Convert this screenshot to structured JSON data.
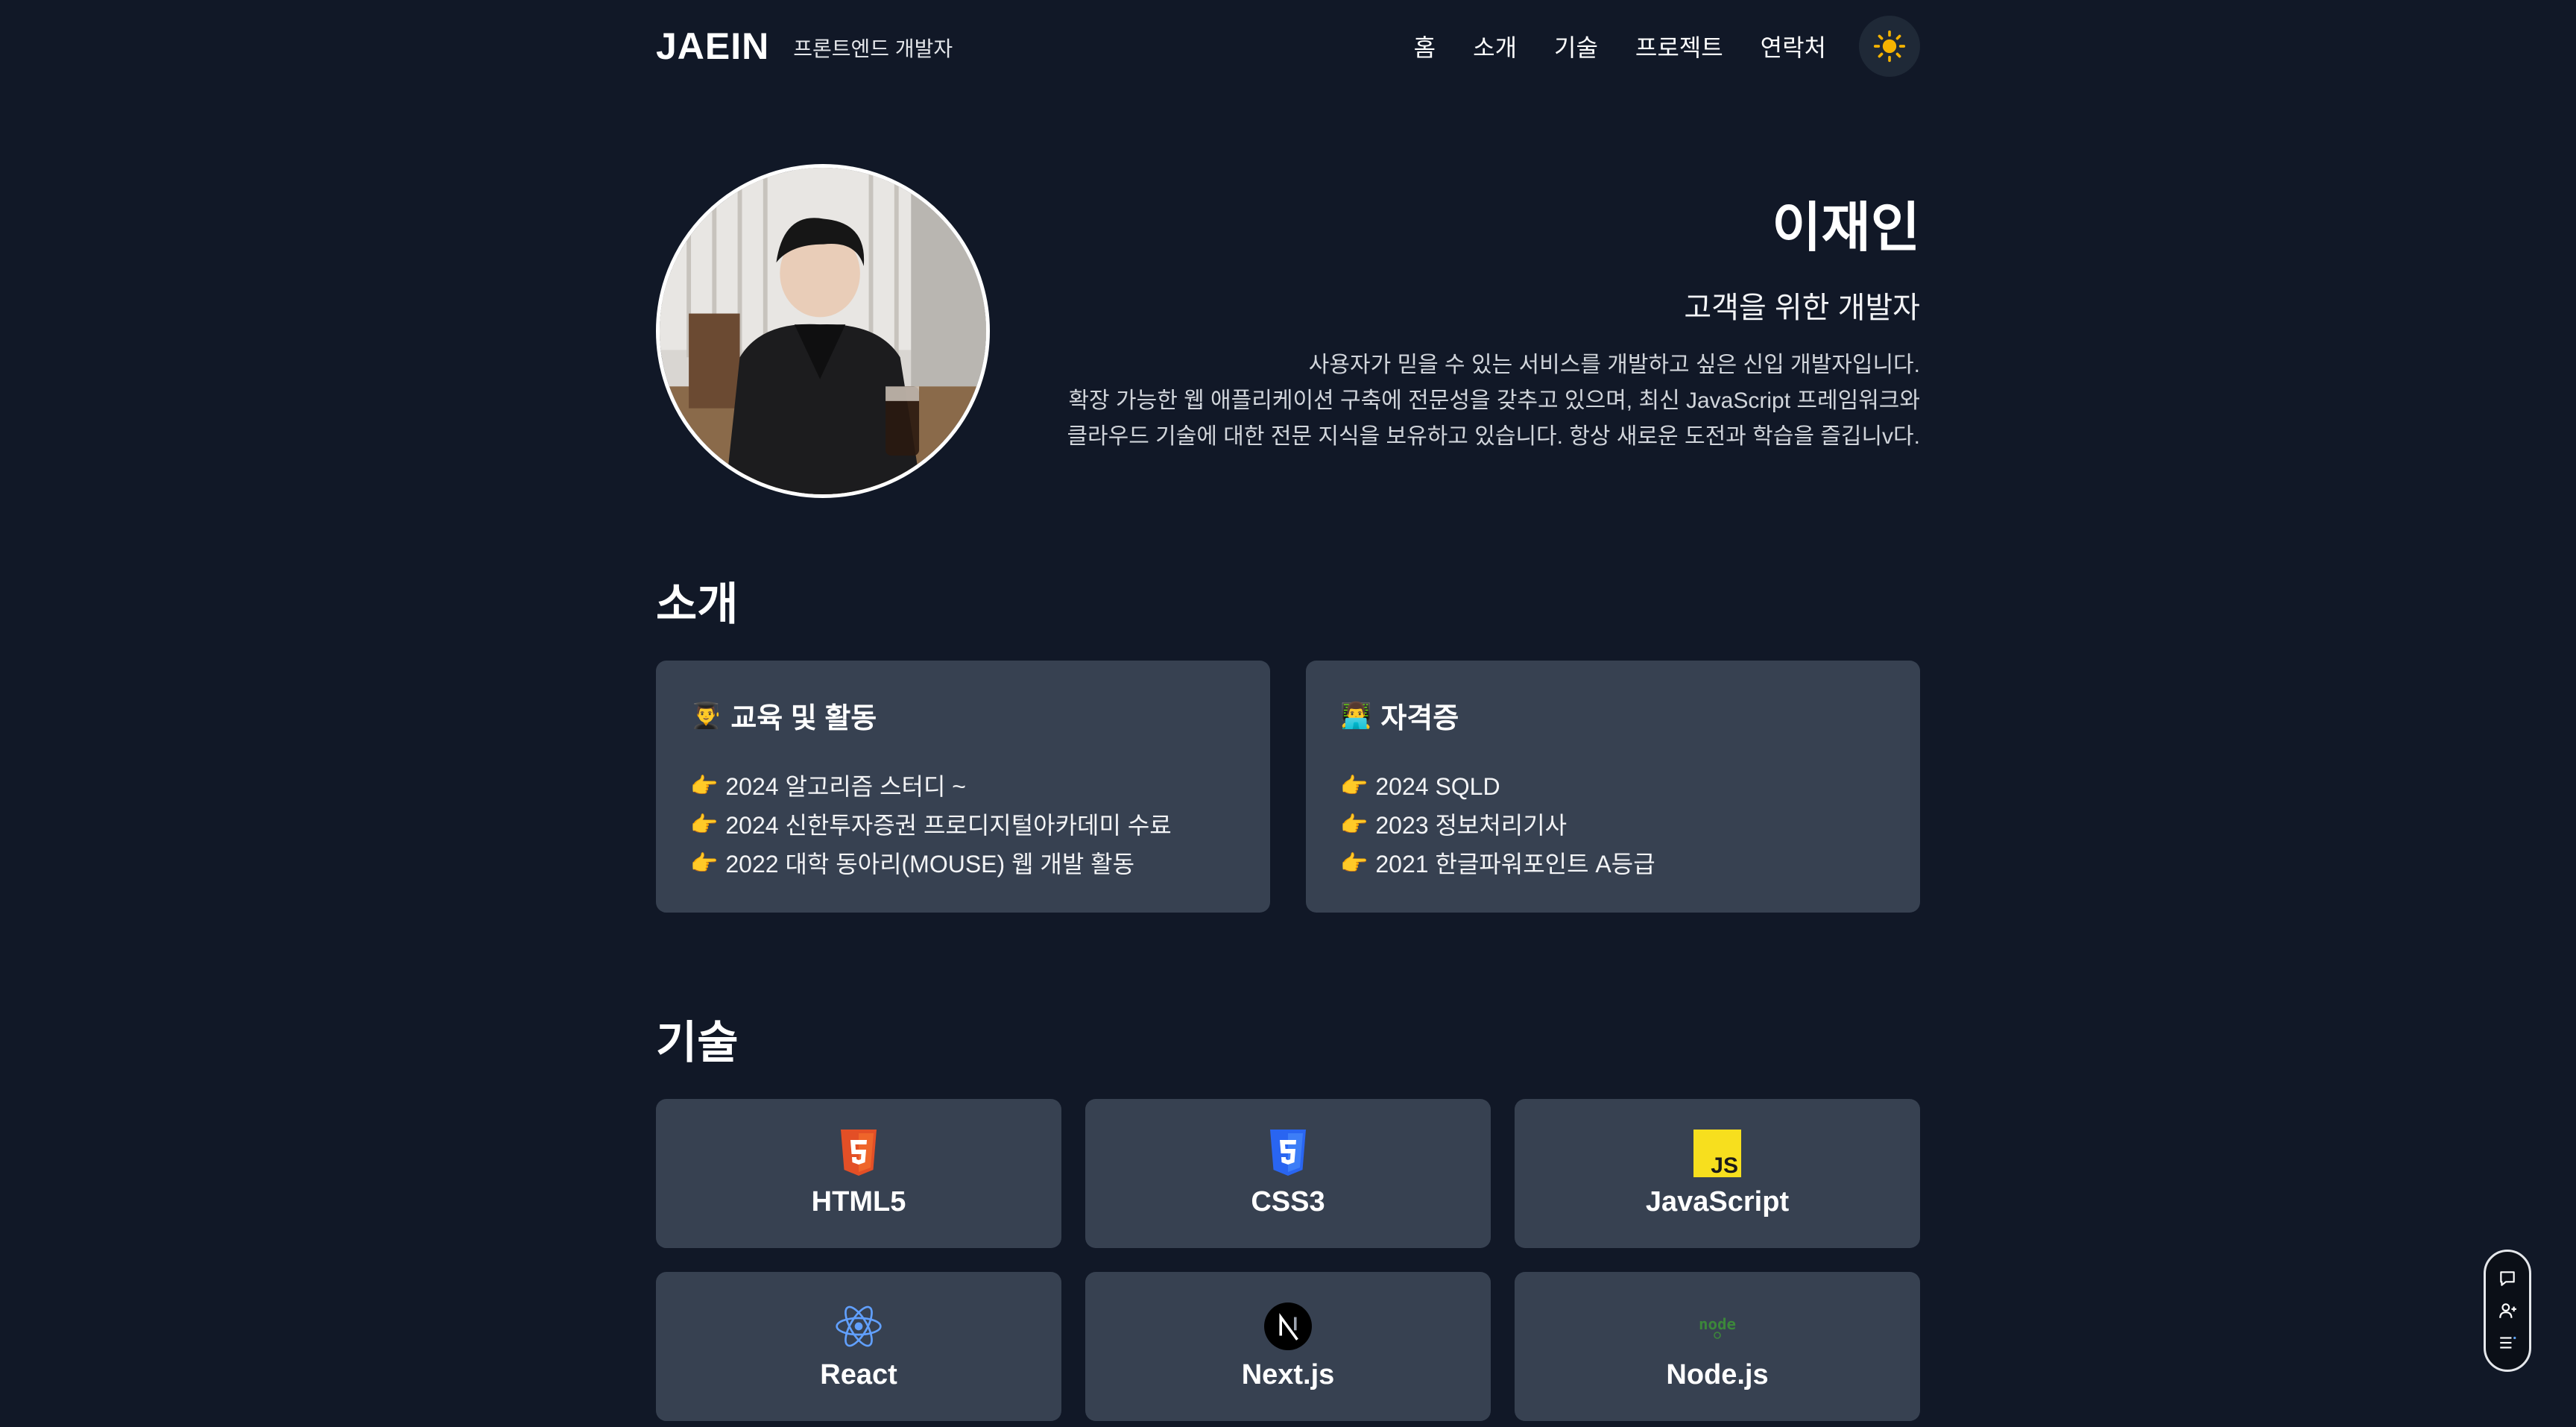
{
  "header": {
    "logo": "JAEIN",
    "tagline": "프론트엔드 개발자",
    "nav": [
      {
        "label": "홈"
      },
      {
        "label": "소개"
      },
      {
        "label": "기술"
      },
      {
        "label": "프로젝트"
      },
      {
        "label": "연락처"
      }
    ],
    "theme_toggle_icon": "sun-icon"
  },
  "hero": {
    "name": "이재인",
    "role": "고객을 위한 개발자",
    "description": [
      "사용자가 믿을 수 있는 서비스를 개발하고 싶은 신입 개발자입니다.",
      "확장 가능한 웹 애플리케이션 구축에 전문성을 갖추고 있으며, 최신 JavaScript 프레임워크와",
      "클라우드 기술에 대한 전문 지식을 보유하고 있습니다. 항상 새로운 도전과 학습을 즐깁니v다."
    ]
  },
  "about": {
    "title": "소개",
    "cards": [
      {
        "emoji": "👨‍🎓",
        "title": "교육 및 활동",
        "items": [
          "2024 알고리즘 스터디 ~",
          "2024 신한투자증권 프로디지털아카데미 수료",
          "2022 대학 동아리(MOUSE) 웹 개발 활동"
        ]
      },
      {
        "emoji": "👨‍💻",
        "title": "자격증",
        "items": [
          "2024 SQLD",
          "2023 정보처리기사",
          "2021 한글파워포인트 A등급"
        ]
      }
    ],
    "bullet": "👉"
  },
  "skills": {
    "title": "기술",
    "items": [
      {
        "label": "HTML5",
        "icon": "html5-icon"
      },
      {
        "label": "CSS3",
        "icon": "css3-icon"
      },
      {
        "label": "JavaScript",
        "icon": "javascript-icon"
      },
      {
        "label": "React",
        "icon": "react-icon"
      },
      {
        "label": "Next.js",
        "icon": "nextjs-icon"
      },
      {
        "label": "Node.js",
        "icon": "nodejs-icon"
      }
    ]
  },
  "floating_widget": {
    "icons": [
      "chat-icon",
      "add-user-icon",
      "menu-list-icon"
    ]
  },
  "colors": {
    "background": "#111827",
    "card": "#374151",
    "html5": "#e34f26",
    "css3": "#2965f1",
    "javascript": "#f7df1e",
    "react": "#61a0ff",
    "node": "#3c873a",
    "sun": "#f5b301"
  }
}
